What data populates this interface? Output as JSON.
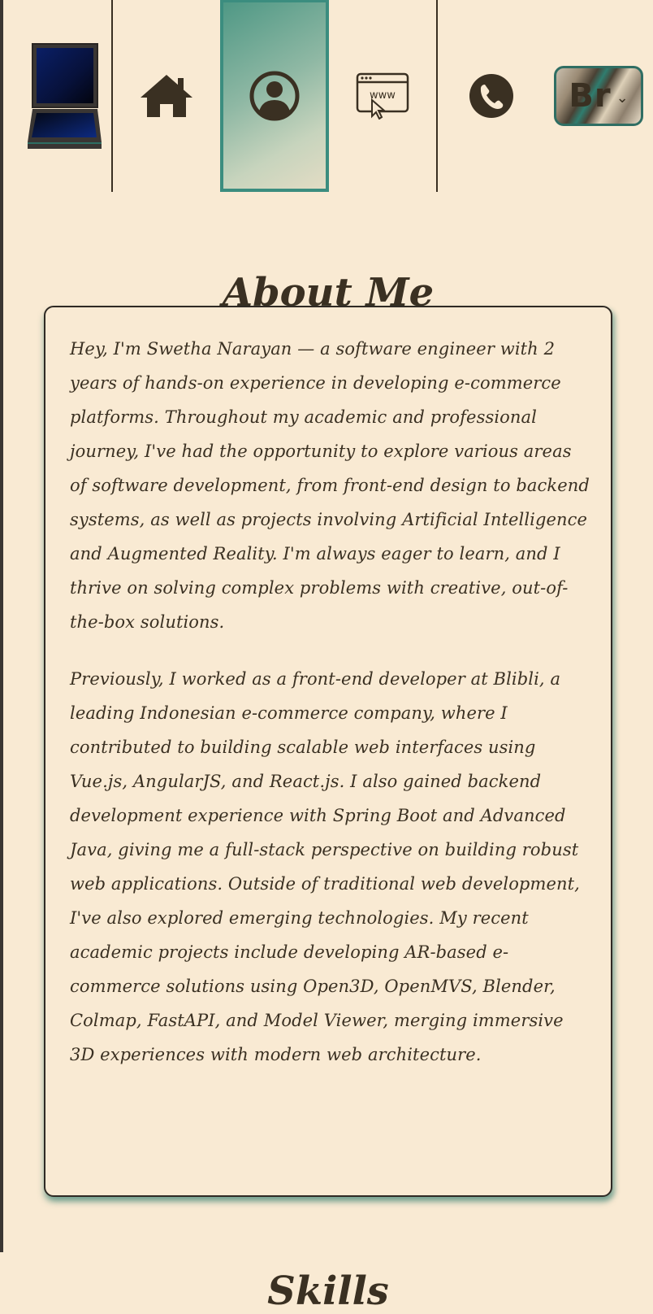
{
  "nav": {
    "items": [
      {
        "icon": "laptop-icon"
      },
      {
        "icon": "home-icon"
      },
      {
        "icon": "user-profile-icon",
        "active": true
      },
      {
        "icon": "website-www-icon"
      },
      {
        "icon": "phone-icon"
      }
    ],
    "language_button": {
      "label": "Br",
      "icon": "chevron-down-icon"
    }
  },
  "about": {
    "title": "About Me",
    "paragraphs": [
      "Hey, I'm Swetha Narayan — a software engineer with 2 years of hands-on experience in developing e-commerce platforms. Throughout my academic and professional journey, I've had the opportunity to explore various areas of software development, from front-end design to backend systems, as well as projects involving Artificial Intelligence and Augmented Reality. I'm always eager to learn, and I thrive on solving complex problems with creative, out-of-the-box solutions.",
      "Previously, I worked as a front-end developer at Blibli, a leading Indonesian e-commerce company, where I contributed to building scalable web interfaces using Vue.js, AngularJS, and React.js. I also gained backend development experience with Spring Boot and Advanced Java, giving me a full-stack perspective on building robust web applications. Outside of traditional web development, I've also explored emerging technologies. My recent academic projects include developing AR-based e-commerce solutions using Open3D, OpenMVS, Blender, Colmap, FastAPI, and Model Viewer, merging immersive 3D experiences with modern web architecture."
    ]
  },
  "next_section": {
    "title": "Skills"
  },
  "colors": {
    "background": "#f9ead3",
    "text": "#3a3022",
    "accent_teal": "#3b8d7f",
    "laptop_screen": "#0b2470"
  }
}
